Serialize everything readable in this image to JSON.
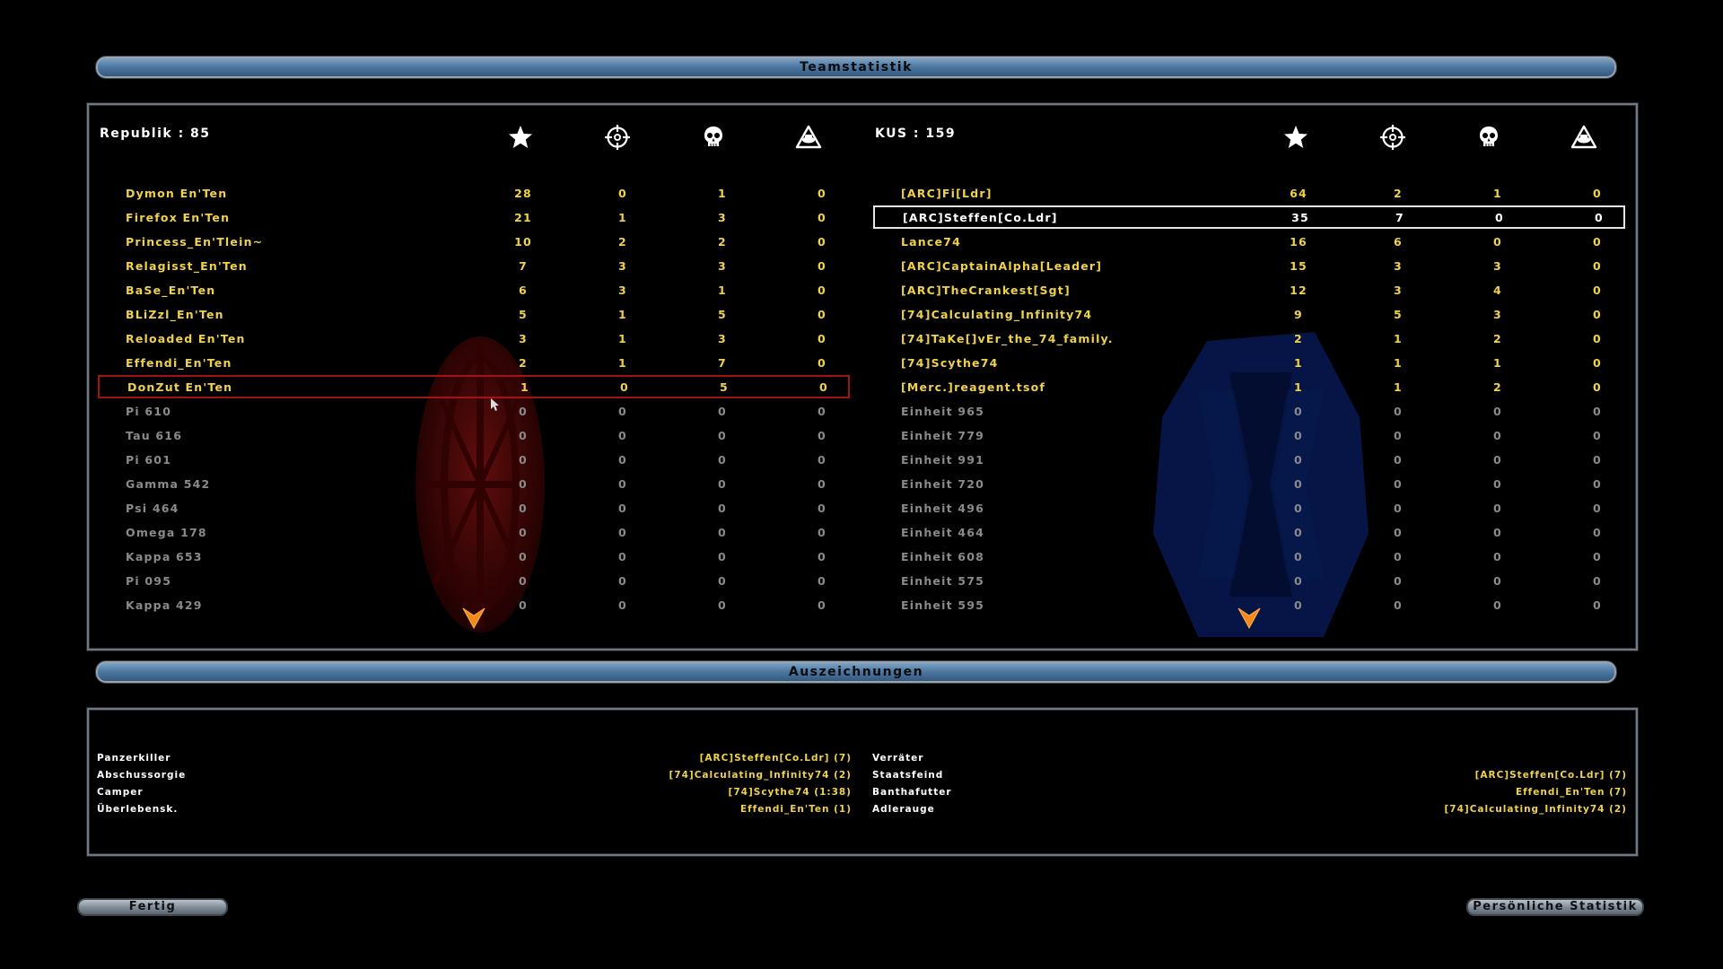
{
  "header": {
    "title": "Teamstatistik"
  },
  "awards_header": {
    "title": "Auszeichnungen"
  },
  "icons": {
    "col1": "star-icon",
    "col2": "crosshair-icon",
    "col3": "skull-icon",
    "col4": "vehicle-warning-icon"
  },
  "teams": {
    "left": {
      "name": "Republik : 85",
      "color": "#c0201c",
      "players": [
        {
          "name": "Dymon En'Ten",
          "stats": [
            "28",
            "0",
            "1",
            "0"
          ]
        },
        {
          "name": "Firefox En'Ten",
          "stats": [
            "21",
            "1",
            "3",
            "0"
          ]
        },
        {
          "name": "Princess_En'Tlein~",
          "stats": [
            "10",
            "2",
            "2",
            "0"
          ]
        },
        {
          "name": "Relagisst_En'Ten",
          "stats": [
            "7",
            "3",
            "3",
            "0"
          ]
        },
        {
          "name": "BaSe_En'Ten",
          "stats": [
            "6",
            "3",
            "1",
            "0"
          ]
        },
        {
          "name": "BLiZzl_En'Ten",
          "stats": [
            "5",
            "1",
            "5",
            "0"
          ]
        },
        {
          "name": "Reloaded En'Ten",
          "stats": [
            "3",
            "1",
            "3",
            "0"
          ]
        },
        {
          "name": "Effendi_En'Ten",
          "stats": [
            "2",
            "1",
            "7",
            "0"
          ]
        },
        {
          "name": "DonZut En'Ten",
          "stats": [
            "1",
            "0",
            "5",
            "0"
          ],
          "selected": "red"
        },
        {
          "name": "Pi 610",
          "stats": [
            "0",
            "0",
            "0",
            "0"
          ],
          "inactive": true
        },
        {
          "name": "Tau 616",
          "stats": [
            "0",
            "0",
            "0",
            "0"
          ],
          "inactive": true
        },
        {
          "name": "Pi 601",
          "stats": [
            "0",
            "0",
            "0",
            "0"
          ],
          "inactive": true
        },
        {
          "name": "Gamma 542",
          "stats": [
            "0",
            "0",
            "0",
            "0"
          ],
          "inactive": true
        },
        {
          "name": "Psi 464",
          "stats": [
            "0",
            "0",
            "0",
            "0"
          ],
          "inactive": true
        },
        {
          "name": "Omega 178",
          "stats": [
            "0",
            "0",
            "0",
            "0"
          ],
          "inactive": true
        },
        {
          "name": "Kappa 653",
          "stats": [
            "0",
            "0",
            "0",
            "0"
          ],
          "inactive": true
        },
        {
          "name": "Pi 095",
          "stats": [
            "0",
            "0",
            "0",
            "0"
          ],
          "inactive": true
        },
        {
          "name": "Kappa 429",
          "stats": [
            "0",
            "0",
            "0",
            "0"
          ],
          "inactive": true
        }
      ]
    },
    "right": {
      "name": "KUS : 159",
      "color": "#1c3fb0",
      "players": [
        {
          "name": "[ARC]Fi[Ldr]",
          "stats": [
            "64",
            "2",
            "1",
            "0"
          ]
        },
        {
          "name": "[ARC]Steffen[Co.Ldr]",
          "stats": [
            "35",
            "7",
            "0",
            "0"
          ],
          "selected": "white"
        },
        {
          "name": "Lance74",
          "stats": [
            "16",
            "6",
            "0",
            "0"
          ]
        },
        {
          "name": "[ARC]CaptainAlpha[Leader]",
          "stats": [
            "15",
            "3",
            "3",
            "0"
          ]
        },
        {
          "name": "[ARC]TheCrankest[Sgt]",
          "stats": [
            "12",
            "3",
            "4",
            "0"
          ]
        },
        {
          "name": "[74]Calculating_Infinity74",
          "stats": [
            "9",
            "5",
            "3",
            "0"
          ]
        },
        {
          "name": "[74]TaKe[]vEr_the_74_family.",
          "stats": [
            "2",
            "1",
            "2",
            "0"
          ]
        },
        {
          "name": "[74]Scythe74",
          "stats": [
            "1",
            "1",
            "1",
            "0"
          ]
        },
        {
          "name": "[Merc.]reagent.tsof",
          "stats": [
            "1",
            "1",
            "2",
            "0"
          ]
        },
        {
          "name": "Einheit 965",
          "stats": [
            "0",
            "0",
            "0",
            "0"
          ],
          "inactive": true
        },
        {
          "name": "Einheit 779",
          "stats": [
            "0",
            "0",
            "0",
            "0"
          ],
          "inactive": true
        },
        {
          "name": "Einheit 991",
          "stats": [
            "0",
            "0",
            "0",
            "0"
          ],
          "inactive": true
        },
        {
          "name": "Einheit 720",
          "stats": [
            "0",
            "0",
            "0",
            "0"
          ],
          "inactive": true
        },
        {
          "name": "Einheit 496",
          "stats": [
            "0",
            "0",
            "0",
            "0"
          ],
          "inactive": true
        },
        {
          "name": "Einheit 464",
          "stats": [
            "0",
            "0",
            "0",
            "0"
          ],
          "inactive": true
        },
        {
          "name": "Einheit 608",
          "stats": [
            "0",
            "0",
            "0",
            "0"
          ],
          "inactive": true
        },
        {
          "name": "Einheit 575",
          "stats": [
            "0",
            "0",
            "0",
            "0"
          ],
          "inactive": true
        },
        {
          "name": "Einheit 595",
          "stats": [
            "0",
            "0",
            "0",
            "0"
          ],
          "inactive": true
        }
      ]
    }
  },
  "awards": {
    "left": [
      {
        "label": "Panzerkiller",
        "value": "[ARC]Steffen[Co.Ldr] (7)"
      },
      {
        "label": "Abschussorgie",
        "value": "[74]Calculating_Infinity74 (2)"
      },
      {
        "label": "Camper",
        "value": "[74]Scythe74 (1:38)"
      },
      {
        "label": "Überlebensk.",
        "value": "Effendi_En'Ten (1)"
      }
    ],
    "right": [
      {
        "label": "Verräter",
        "value": ""
      },
      {
        "label": "Staatsfeind",
        "value": "[ARC]Steffen[Co.Ldr] (7)"
      },
      {
        "label": "Banthafutter",
        "value": "Effendi_En'Ten (7)"
      },
      {
        "label": "Adlerauge",
        "value": "[74]Calculating_Infinity74 (2)"
      }
    ]
  },
  "buttons": {
    "done": "Fertig",
    "personal": "Persönliche Statistik"
  }
}
